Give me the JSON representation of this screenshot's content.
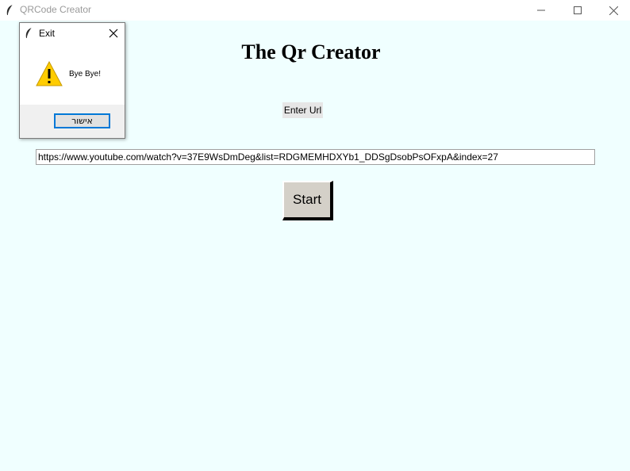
{
  "window": {
    "title": "QRCode Creator",
    "background": "#f0ffff"
  },
  "main": {
    "heading": "The Qr Creator",
    "url_label": "Enter Url",
    "url_value": "https://www.youtube.com/watch?v=37E9WsDmDeg&list=RDGMEMHDXYb1_DDSgDsobPsOFxpA&index=27",
    "start_label": "Start"
  },
  "dialog": {
    "title": "Exit",
    "message": "Bye Bye!",
    "ok_label": "אישור",
    "icon": "warning-icon",
    "accent": "#0078d7"
  },
  "icons": {
    "app": "feather-icon",
    "minimize": "minimize-icon",
    "maximize": "maximize-icon",
    "close": "close-icon"
  }
}
